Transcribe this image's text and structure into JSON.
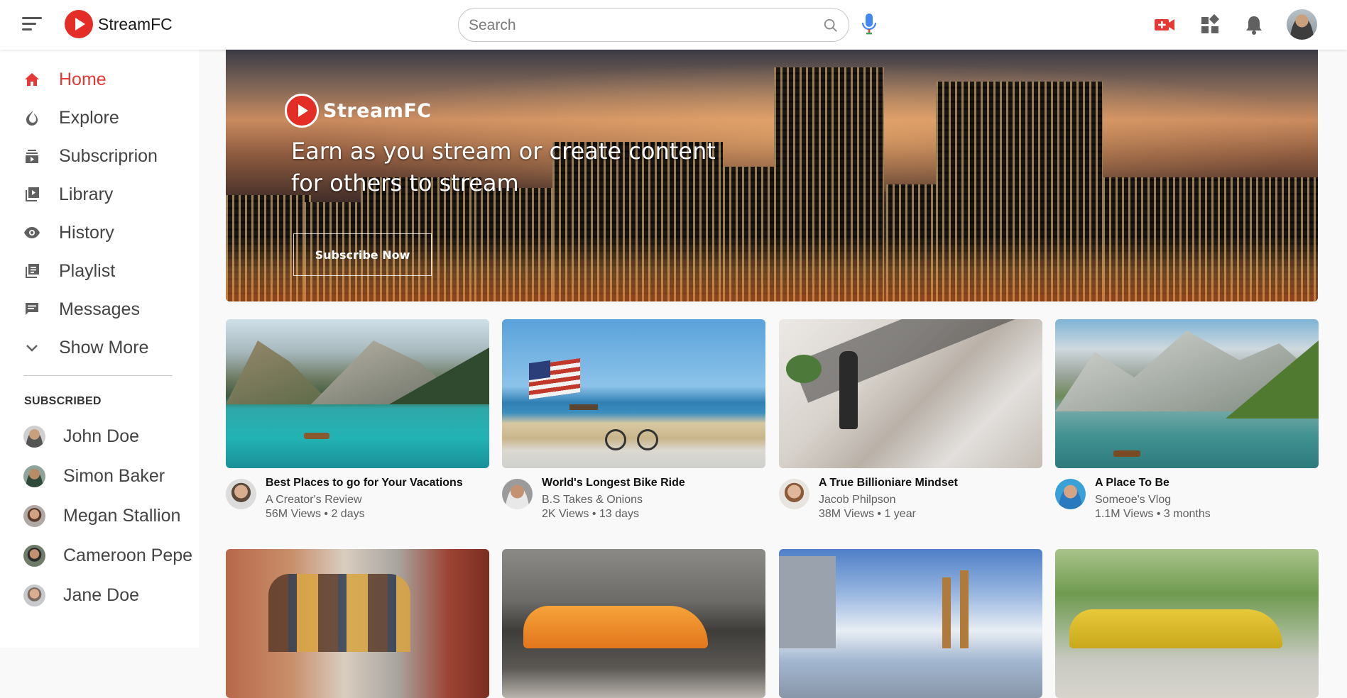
{
  "header": {
    "app_name": "StreamFC",
    "search_placeholder": "Search",
    "brand_color": "#e52d27"
  },
  "sidebar": {
    "items": [
      {
        "label": "Home",
        "icon": "home-icon",
        "active": true
      },
      {
        "label": "Explore",
        "icon": "flame-icon"
      },
      {
        "label": "Subscriprion",
        "icon": "subscriptions-icon"
      },
      {
        "label": "Library",
        "icon": "library-icon"
      },
      {
        "label": "History",
        "icon": "eye-icon"
      },
      {
        "label": "Playlist",
        "icon": "playlist-icon"
      },
      {
        "label": "Messages",
        "icon": "chat-icon"
      },
      {
        "label": "Show More",
        "icon": "chevron-down-icon"
      }
    ],
    "subscribed_title": "SUBSCRIBED",
    "subscribed": [
      {
        "name": "John Doe"
      },
      {
        "name": "Simon Baker"
      },
      {
        "name": "Megan Stallion"
      },
      {
        "name": "Cameroon Pepe"
      },
      {
        "name": "Jane Doe"
      }
    ]
  },
  "banner": {
    "logo_text": "StreamFC",
    "headline_line1": "Earn as you stream or create content",
    "headline_line2": "for others to stream",
    "button_label": "Subscribe Now"
  },
  "videos": [
    {
      "title": "Best Places to go for Your Vacations",
      "channel": "A Creator's Review",
      "meta": "56M Views • 2 days"
    },
    {
      "title": "World's Longest Bike Ride",
      "channel": "B.S Takes & Onions",
      "meta": "2K Views • 13 days"
    },
    {
      "title": "A True Billioniare Mindset",
      "channel": "Jacob Philpson",
      "meta": "38M Views • 1 year"
    },
    {
      "title": "A Place To Be",
      "channel": "Someoe's Vlog",
      "meta": "1.1M Views • 3 months"
    }
  ]
}
